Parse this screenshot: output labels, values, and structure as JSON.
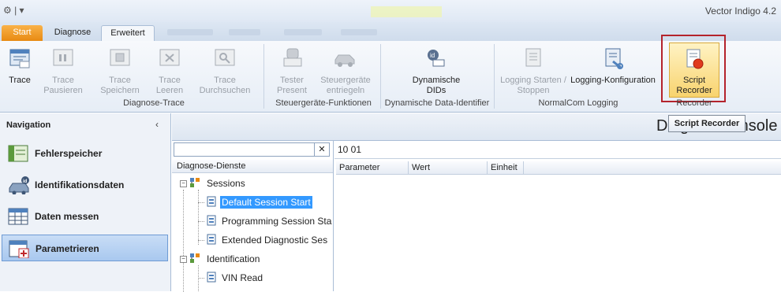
{
  "app": {
    "title": "Vector Indigo 4.2"
  },
  "tabs": [
    "Start",
    "Diagnose",
    "Erweitert"
  ],
  "ribbon": {
    "buttons": [
      {
        "label": "Trace",
        "icon": "trace-icon"
      },
      {
        "label": "Trace Pausieren",
        "icon": "trace-pause-icon"
      },
      {
        "label": "Trace Speichern",
        "icon": "trace-save-icon"
      },
      {
        "label": "Trace Leeren",
        "icon": "trace-clear-icon"
      },
      {
        "label": "Trace Durchsuchen",
        "icon": "trace-search-icon"
      },
      {
        "label": "Tester Present",
        "icon": "tester-present-icon"
      },
      {
        "label": "Steuergeräte entriegeln",
        "icon": "ecu-unlock-icon"
      },
      {
        "label": "Dynamische DIDs",
        "icon": "dynamic-did-icon"
      },
      {
        "label": "Logging Starten / Stoppen",
        "icon": "logging-start-icon"
      },
      {
        "label": "Logging-Konfiguration",
        "icon": "logging-config-icon"
      },
      {
        "label": "Script Recorder",
        "icon": "script-recorder-icon"
      }
    ],
    "groups": [
      "Diagnose-Trace",
      "Steuergeräte-Funktionen",
      "Dynamische Data-Identifier",
      "NormalCom Logging",
      "Recorder"
    ],
    "tooltip": "Script Recorder"
  },
  "navigation": {
    "title": "Navigation",
    "items": [
      {
        "label": "Fehlerspeicher",
        "icon": "fault-memory-icon"
      },
      {
        "label": "Identifikationsdaten",
        "icon": "identification-icon"
      },
      {
        "label": "Daten messen",
        "icon": "measure-data-icon"
      },
      {
        "label": "Parametrieren",
        "icon": "parametrize-icon",
        "selected": true
      }
    ]
  },
  "main": {
    "title": "Diagnosekonsole",
    "command_value": "10 01",
    "tree_header": "Diagnose-Dienste",
    "tree": {
      "sessions_label": "Sessions",
      "sessions": [
        "Default Session Start",
        "Programming Session Sta",
        "Extended Diagnostic Ses"
      ],
      "identification_label": "Identification",
      "identification": [
        "VIN Read"
      ]
    },
    "columns": [
      "Parameter",
      "Wert",
      "Einheit"
    ]
  },
  "colors": {
    "accent_orange": "#e88a12",
    "selection_blue": "#3399ff",
    "highlight_red": "#b4232c"
  }
}
